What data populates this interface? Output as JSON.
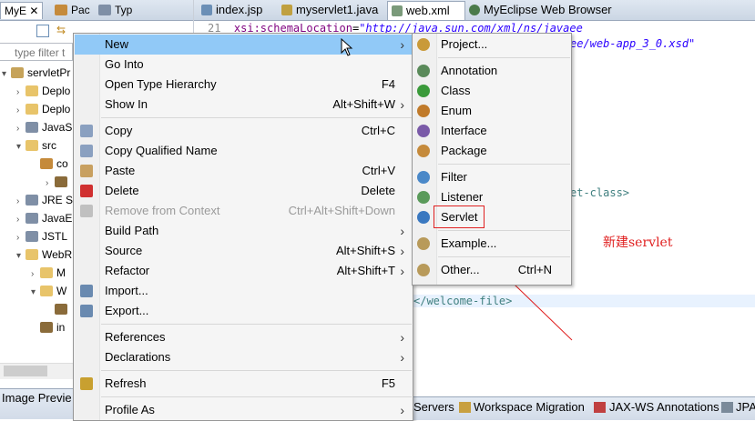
{
  "left_tabs": [
    "MyE",
    "Pac",
    "Typ"
  ],
  "filter_placeholder": "type filter t",
  "tree": [
    {
      "label": "servletPr",
      "indent": 0,
      "arrow": "▾"
    },
    {
      "label": "Deplo",
      "indent": 1,
      "arrow": "›"
    },
    {
      "label": "Deplo",
      "indent": 1,
      "arrow": "›"
    },
    {
      "label": "JavaS",
      "indent": 1,
      "arrow": "›"
    },
    {
      "label": "src",
      "indent": 1,
      "arrow": "▾"
    },
    {
      "label": "co",
      "indent": 2,
      "arrow": ""
    },
    {
      "label": "",
      "indent": 3,
      "arrow": "›"
    },
    {
      "label": "JRE S",
      "indent": 1,
      "arrow": "›"
    },
    {
      "label": "JavaE",
      "indent": 1,
      "arrow": "›"
    },
    {
      "label": "JSTL",
      "indent": 1,
      "arrow": "›"
    },
    {
      "label": "WebR",
      "indent": 1,
      "arrow": "▾"
    },
    {
      "label": "M",
      "indent": 2,
      "arrow": "›"
    },
    {
      "label": "W",
      "indent": 2,
      "arrow": "▾"
    },
    {
      "label": "",
      "indent": 3,
      "arrow": ""
    },
    {
      "label": "in",
      "indent": 2,
      "arrow": ""
    }
  ],
  "left_bottom_tab": "Image Previe",
  "editor_tabs": [
    {
      "label": "index.jsp",
      "color": "#6b8fb6"
    },
    {
      "label": "myservlet1.java",
      "color": "#c0a040"
    },
    {
      "label": "web.xml",
      "color": "#7a9a7a"
    },
    {
      "label": "MyEclipse Web Browser",
      "color": "#4a7a4a"
    }
  ],
  "code": {
    "line_number": "21",
    "attr": "xsi:schemaLocation",
    "value1": "\"http://java.sun.com/xml/ns/javaee",
    "value2": "ee/web-app_3_0.xsd\"",
    "fragment1": "et-class>",
    "fragment2": "</welcome-file>"
  },
  "annotation": "新建servlet",
  "context_menu": [
    {
      "label": "New",
      "shortcut": "",
      "submenu": true,
      "highlighted": true
    },
    {
      "label": "Go Into",
      "shortcut": ""
    },
    {
      "label": "Open Type Hierarchy",
      "shortcut": "F4"
    },
    {
      "label": "Show In",
      "shortcut": "Alt+Shift+W",
      "submenu": true
    },
    {
      "separator": true
    },
    {
      "label": "Copy",
      "shortcut": "Ctrl+C",
      "icon": "copy-icon"
    },
    {
      "label": "Copy Qualified Name",
      "shortcut": "",
      "icon": "copy-qualified-icon"
    },
    {
      "label": "Paste",
      "shortcut": "Ctrl+V",
      "icon": "paste-icon"
    },
    {
      "label": "Delete",
      "shortcut": "Delete",
      "icon": "delete-icon"
    },
    {
      "label": "Remove from Context",
      "shortcut": "Ctrl+Alt+Shift+Down",
      "disabled": true,
      "icon": "remove-context-icon"
    },
    {
      "label": "Build Path",
      "shortcut": "",
      "submenu": true
    },
    {
      "label": "Source",
      "shortcut": "Alt+Shift+S",
      "submenu": true
    },
    {
      "label": "Refactor",
      "shortcut": "Alt+Shift+T",
      "submenu": true
    },
    {
      "label": "Import...",
      "shortcut": "",
      "icon": "import-icon"
    },
    {
      "label": "Export...",
      "shortcut": "",
      "icon": "export-icon"
    },
    {
      "separator": true
    },
    {
      "label": "References",
      "shortcut": "",
      "submenu": true
    },
    {
      "label": "Declarations",
      "shortcut": "",
      "submenu": true
    },
    {
      "separator": true
    },
    {
      "label": "Refresh",
      "shortcut": "F5",
      "icon": "refresh-icon"
    },
    {
      "separator": true
    },
    {
      "label": "Profile As",
      "shortcut": "",
      "submenu": true
    }
  ],
  "submenu": [
    {
      "label": "Project...",
      "shortcut": "",
      "icon": "project-icon",
      "color": "#c99a3a"
    },
    {
      "separator": true
    },
    {
      "label": "Annotation",
      "shortcut": "",
      "icon": "annotation-icon",
      "color": "#5a8a5a"
    },
    {
      "label": "Class",
      "shortcut": "",
      "icon": "class-icon",
      "color": "#3a9a3a"
    },
    {
      "label": "Enum",
      "shortcut": "",
      "icon": "enum-icon",
      "color": "#c07a2a"
    },
    {
      "label": "Interface",
      "shortcut": "",
      "icon": "interface-icon",
      "color": "#7a5aa8"
    },
    {
      "label": "Package",
      "shortcut": "",
      "icon": "package-icon",
      "color": "#c58a3b"
    },
    {
      "separator": true
    },
    {
      "label": "Filter",
      "shortcut": "",
      "icon": "filter-icon",
      "color": "#4a88c8"
    },
    {
      "label": "Listener",
      "shortcut": "",
      "icon": "listener-icon",
      "color": "#5a9a5a"
    },
    {
      "label": "Servlet",
      "shortcut": "",
      "icon": "servlet-icon",
      "color": "#3a78c0"
    },
    {
      "separator": true
    },
    {
      "label": "Example...",
      "shortcut": "",
      "icon": "example-icon",
      "color": "#b89a5a"
    },
    {
      "separator": true
    },
    {
      "label": "Other...",
      "shortcut": "Ctrl+N",
      "icon": "other-icon",
      "color": "#b89a5a"
    }
  ],
  "bottom_right_tabs": [
    "Servers",
    "Workspace Migration",
    "JAX-WS Annotations",
    "JPA"
  ]
}
